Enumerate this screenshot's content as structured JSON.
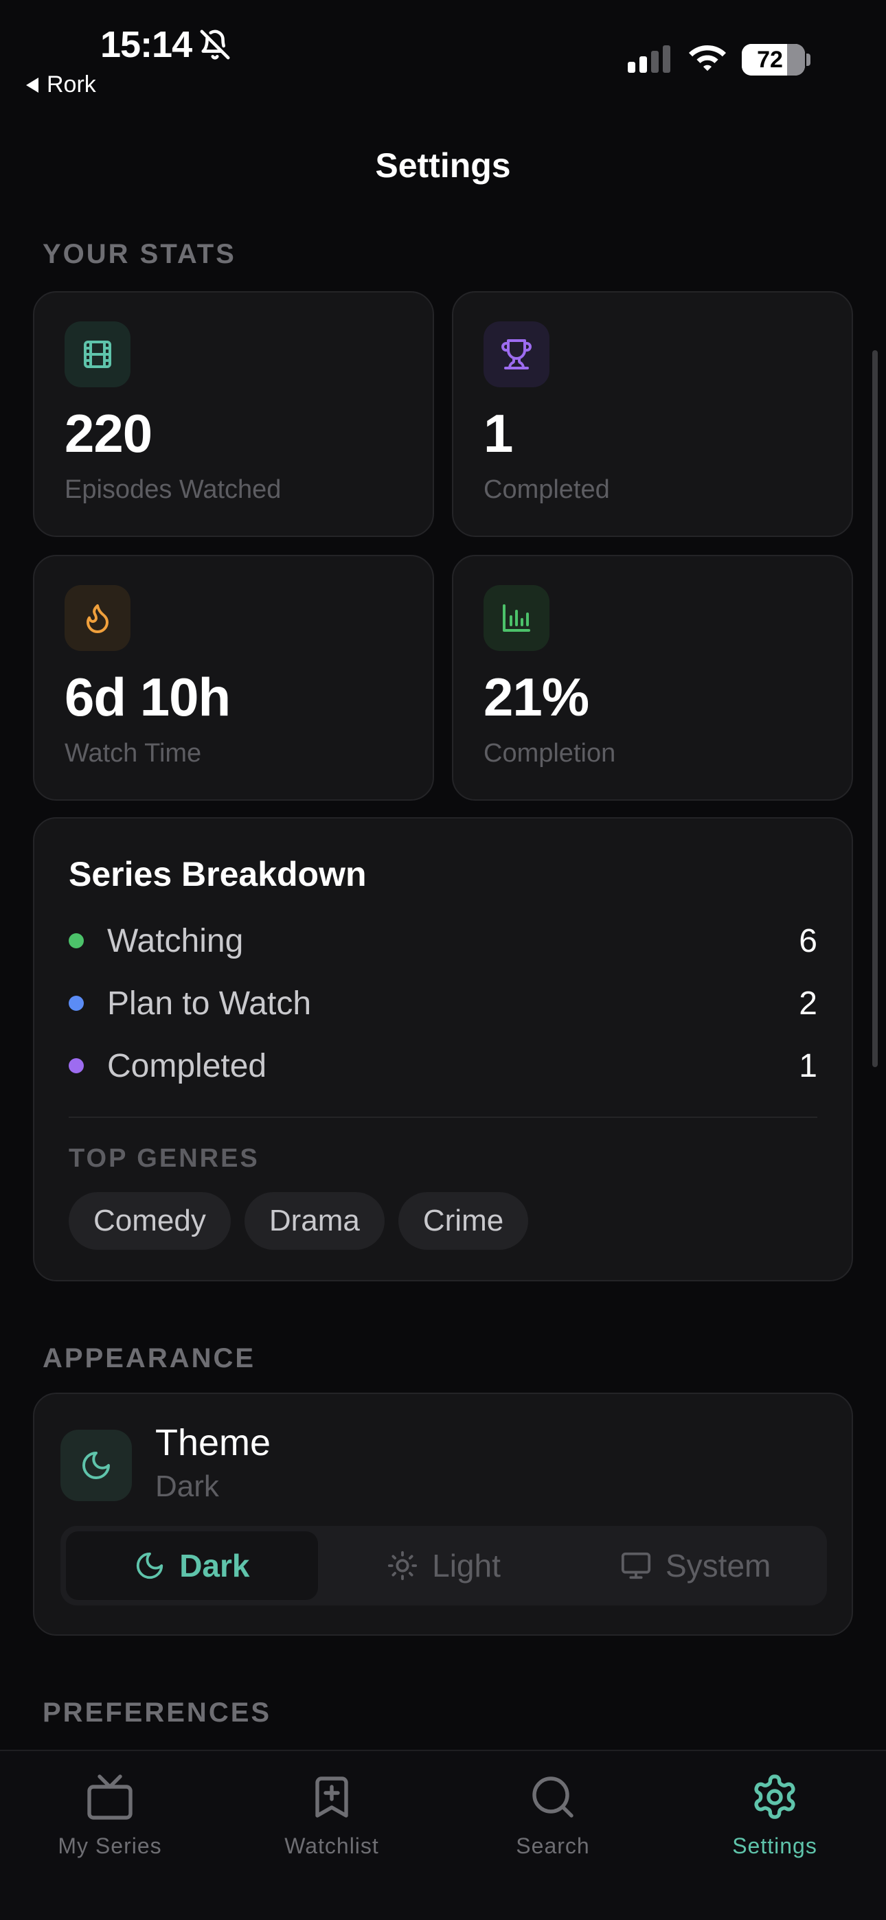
{
  "status_bar": {
    "time": "15:14",
    "back_label": "Rork",
    "battery": "72"
  },
  "header": {
    "title": "Settings"
  },
  "stats": {
    "section_label": "YOUR STATS",
    "cards": [
      {
        "value": "220",
        "label": "Episodes Watched",
        "icon": "film-icon",
        "accent": "#5fc4ab"
      },
      {
        "value": "1",
        "label": "Completed",
        "icon": "trophy-icon",
        "accent": "#9d6cf0"
      },
      {
        "value": "6d 10h",
        "label": "Watch Time",
        "icon": "flame-icon",
        "accent": "#f0a03c"
      },
      {
        "value": "21%",
        "label": "Completion",
        "icon": "bar-chart-icon",
        "accent": "#4cc26a"
      }
    ]
  },
  "breakdown": {
    "title": "Series Breakdown",
    "rows": [
      {
        "name": "Watching",
        "count": "6",
        "color": "#4cc26a"
      },
      {
        "name": "Plan to Watch",
        "count": "2",
        "color": "#5b8cf5"
      },
      {
        "name": "Completed",
        "count": "1",
        "color": "#9d6cf0"
      }
    ],
    "genres_label": "TOP GENRES",
    "genres": [
      "Comedy",
      "Drama",
      "Crime"
    ]
  },
  "appearance": {
    "section_label": "APPEARANCE",
    "theme_title": "Theme",
    "theme_value": "Dark",
    "options": [
      {
        "label": "Dark",
        "icon": "moon-icon",
        "selected": true
      },
      {
        "label": "Light",
        "icon": "sun-icon",
        "selected": false
      },
      {
        "label": "System",
        "icon": "monitor-icon",
        "selected": false
      }
    ]
  },
  "preferences": {
    "section_label": "PREFERENCES"
  },
  "tabbar": {
    "tabs": [
      {
        "label": "My Series",
        "icon": "tv-icon",
        "active": false
      },
      {
        "label": "Watchlist",
        "icon": "bookmark-plus-icon",
        "active": false
      },
      {
        "label": "Search",
        "icon": "search-icon",
        "active": false
      },
      {
        "label": "Settings",
        "icon": "gear-icon",
        "active": true
      }
    ]
  },
  "colors": {
    "accent": "#5fc4ab",
    "background": "#0a0a0c",
    "card": "#151517"
  }
}
